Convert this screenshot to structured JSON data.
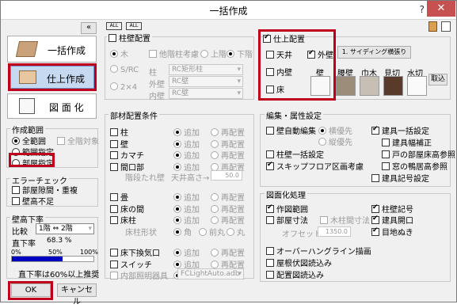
{
  "window": {
    "title": "一括作成",
    "help": "?",
    "close": "✕"
  },
  "sidebar": {
    "collapse": "«",
    "btn1": "一括作成",
    "btn2": "仕上作成",
    "btn3": "図 面 化"
  },
  "scope": {
    "title": "作成範囲",
    "all": "全範囲",
    "target": "全階対象",
    "range": "範囲指定",
    "room": "部屋指定"
  },
  "errcheck": {
    "title": "エラーチェック",
    "gap": "部屋隙間・重複",
    "wallheight": "壁高不足"
  },
  "height": {
    "title": "壁高下率",
    "compare_label": "比較",
    "compare_value": "1階 ⇔ 2階",
    "rate_label": "直下率",
    "rate_value": "68.3 %",
    "s0": "0%",
    "s50": "50%",
    "s100": "100%",
    "progress": 0.62,
    "note": "直下率は60%以上推奨"
  },
  "ok": "OK",
  "cancel": "キャンセル",
  "toolbar": {
    "all": "ALL",
    "all2": "ALL"
  },
  "pillar": {
    "title": "柱壁配置",
    "wood": "木",
    "sub": "他階柱考慮",
    "up": "上階",
    "down": "下階",
    "src": "S/RC",
    "x2": "2×4",
    "col": "柱",
    "col_value": "RC矩形柱",
    "out": "外壁",
    "out_value": "RC壁",
    "in": "内壁",
    "in_value": "RC壁"
  },
  "parts": {
    "title": "部材配置条件",
    "add": "追加",
    "re": "再配置",
    "rows": [
      "柱",
      "壁",
      "カマチ",
      "間口部"
    ],
    "hidden": "階段たれ壁",
    "ceil": "天井高さ→",
    "ceil_value": "50.0",
    "rows2": [
      "畳",
      "床の間",
      "床柱"
    ],
    "pillar_shape": "床柱形状",
    "square": "角",
    "ffront": "前丸",
    "round": "丸",
    "rows3": [
      "床下換気口",
      "スイッチ",
      "内部照明器具"
    ],
    "light_value": "FCLightAuto.adb"
  },
  "finish": {
    "title": "仕上配置",
    "ceiling": "天井",
    "outer": "外壁",
    "inner": "内壁",
    "floor": "床",
    "siding": "1. サイディング横張り",
    "wall": "壁",
    "koshi": "腰壁",
    "haba": "巾木",
    "mikiri": "見切",
    "mizukiri": "水切",
    "add": "取込"
  },
  "edit": {
    "title": "編集・属性設定",
    "auto": "壁自動編集",
    "inner": "横優先",
    "vert": "縦優先",
    "setting": "柱壁一括設定",
    "skip": "スキップフロア区画考慮",
    "fixt": "建具一括設定",
    "fixt_w": "建具幅補正",
    "door": "戸の部屋床高参照",
    "window": "窓の鴨居高参照",
    "symbol": "建具記号設定"
  },
  "draw": {
    "title": "図面化処理",
    "make": "作図範囲",
    "dim": "部屋寸法",
    "col_dim": "木柱間寸法",
    "offset": "オフセット",
    "offset_value": "1350.0",
    "pil": "柱壁記号",
    "opening": "建具開口",
    "joint": "目地ぬき",
    "overhang": "オーバーハングライン描画",
    "roof": "屋根伏図読込み",
    "layout": "配置図読込み"
  },
  "colors": {
    "red": "#c0001a",
    "selected": "#c5d9f1"
  }
}
